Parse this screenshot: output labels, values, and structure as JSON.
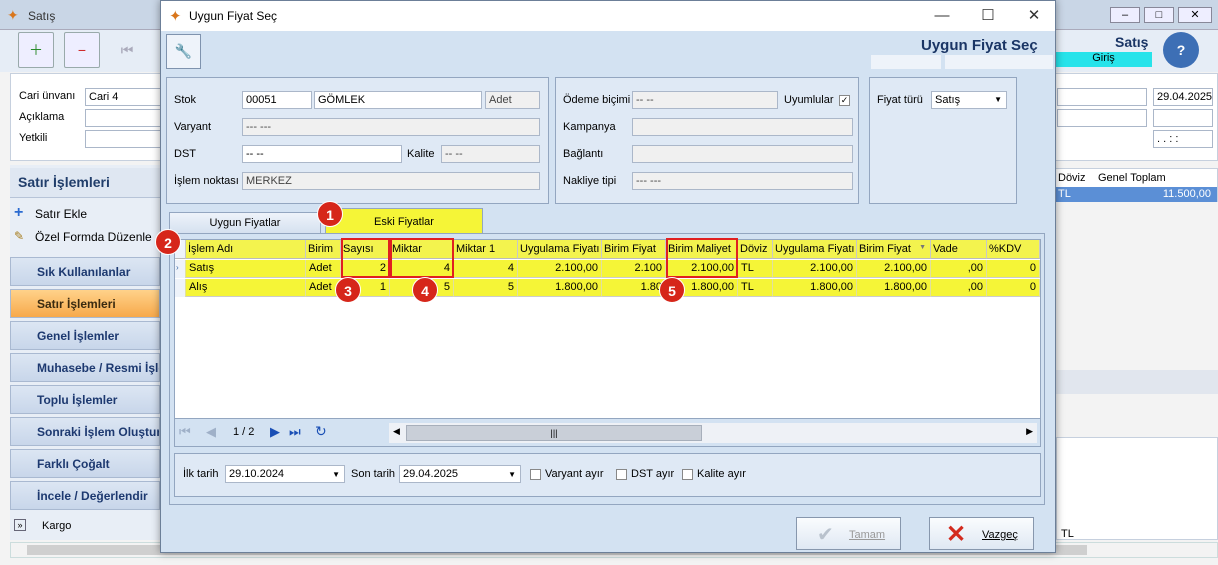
{
  "main_window": {
    "title": "Satış",
    "form_header": "Satış",
    "status": "Giriş",
    "labels": {
      "cari_unvani": "Cari ünvanı",
      "aciklama": "Açıklama",
      "yetkili": "Yetkili"
    },
    "cari_value": "Cari 4",
    "date_value": "29.04.2025",
    "time_mask": ".  .    :  :",
    "grid_headers": {
      "doviz": "Döviz",
      "genel_toplam": "Genel Toplam"
    },
    "grid_row": {
      "doviz": "TL",
      "genel_toplam": "11.500,00"
    },
    "footer_tl": "TL"
  },
  "left_nav": {
    "header": "Satır İşlemleri",
    "actions": [
      "Satır Ekle",
      "Özel Formda Düzenle"
    ],
    "groups": [
      "Sık Kullanılanlar",
      "Satır İşlemleri",
      "Genel İşlemler",
      "Muhasebe / Resmi İşlemler",
      "Toplu İşlemler",
      "Sonraki İşlem Oluştur",
      "Farklı Çoğalt",
      "İncele / Değerlendir"
    ],
    "selected_group": "Satır İşlemleri",
    "bottom_item": "Kargo"
  },
  "dialog": {
    "title": "Uygun Fiyat Seç",
    "heading": "Uygun Fiyat Seç",
    "stok": {
      "label": "Stok",
      "code": "00051",
      "name": "GÖMLEK",
      "unit": "Adet"
    },
    "varyant": {
      "label": "Varyant",
      "value": "--- ---"
    },
    "dst": {
      "label": "DST",
      "value": "-- --"
    },
    "kalite": {
      "label": "Kalite",
      "value": "-- --"
    },
    "islem_noktasi": {
      "label": "İşlem noktası",
      "value": "MERKEZ"
    },
    "odeme_bicimi": {
      "label": "Ödeme biçimi",
      "value": "-- --"
    },
    "uyumlular": {
      "label": "Uyumlular",
      "checked": true
    },
    "kampanya": {
      "label": "Kampanya",
      "value": ""
    },
    "baglanti": {
      "label": "Bağlantı",
      "value": ""
    },
    "nakliye_tipi": {
      "label": "Nakliye tipi",
      "value": "--- ---"
    },
    "fiyat_turu": {
      "label": "Fiyat türü",
      "value": "Satış"
    },
    "tabs": [
      {
        "label": "Uygun Fiyatlar",
        "active": false
      },
      {
        "label": "Eski Fiyatlar",
        "active": true
      }
    ],
    "grid": {
      "columns": [
        "İşlem Adı",
        "Birim",
        "Sayısı",
        "Miktar",
        "Miktar 1",
        "Uygulama Fiyatı",
        "Birim Fiyat",
        "Birim Maliyet",
        "Döviz",
        "Uygulama Fiyatı",
        "Birim Fiyat",
        "Vade",
        "%KDV"
      ],
      "rows": [
        [
          "Satış",
          "Adet",
          "2",
          "4",
          "4",
          "2.100,00",
          "2.100",
          "2.100,00",
          "TL",
          "2.100,00",
          "2.100,00",
          ",00",
          "0"
        ],
        [
          "Alış",
          "Adet",
          "1",
          "5",
          "5",
          "1.800,00",
          "1.80",
          "1.800,00",
          "TL",
          "1.800,00",
          "1.800,00",
          ",00",
          "0"
        ]
      ],
      "pager": "1 / 2"
    },
    "ilk_tarih": {
      "label": "İlk tarih",
      "value": "29.10.2024"
    },
    "son_tarih": {
      "label": "Son tarih",
      "value": "29.04.2025"
    },
    "checks": [
      "Varyant ayır",
      "DST ayır",
      "Kalite ayır"
    ],
    "buttons": {
      "tamam": "Tamam",
      "vazgec": "Vazgeç"
    },
    "annotations": [
      "1",
      "2",
      "3",
      "4",
      "5"
    ]
  },
  "colors": {
    "grid_yellow": "#f5f537",
    "accent_red": "#e02020",
    "nav_selected": "#f7a94b",
    "status_cyan": "#27e3ea"
  }
}
